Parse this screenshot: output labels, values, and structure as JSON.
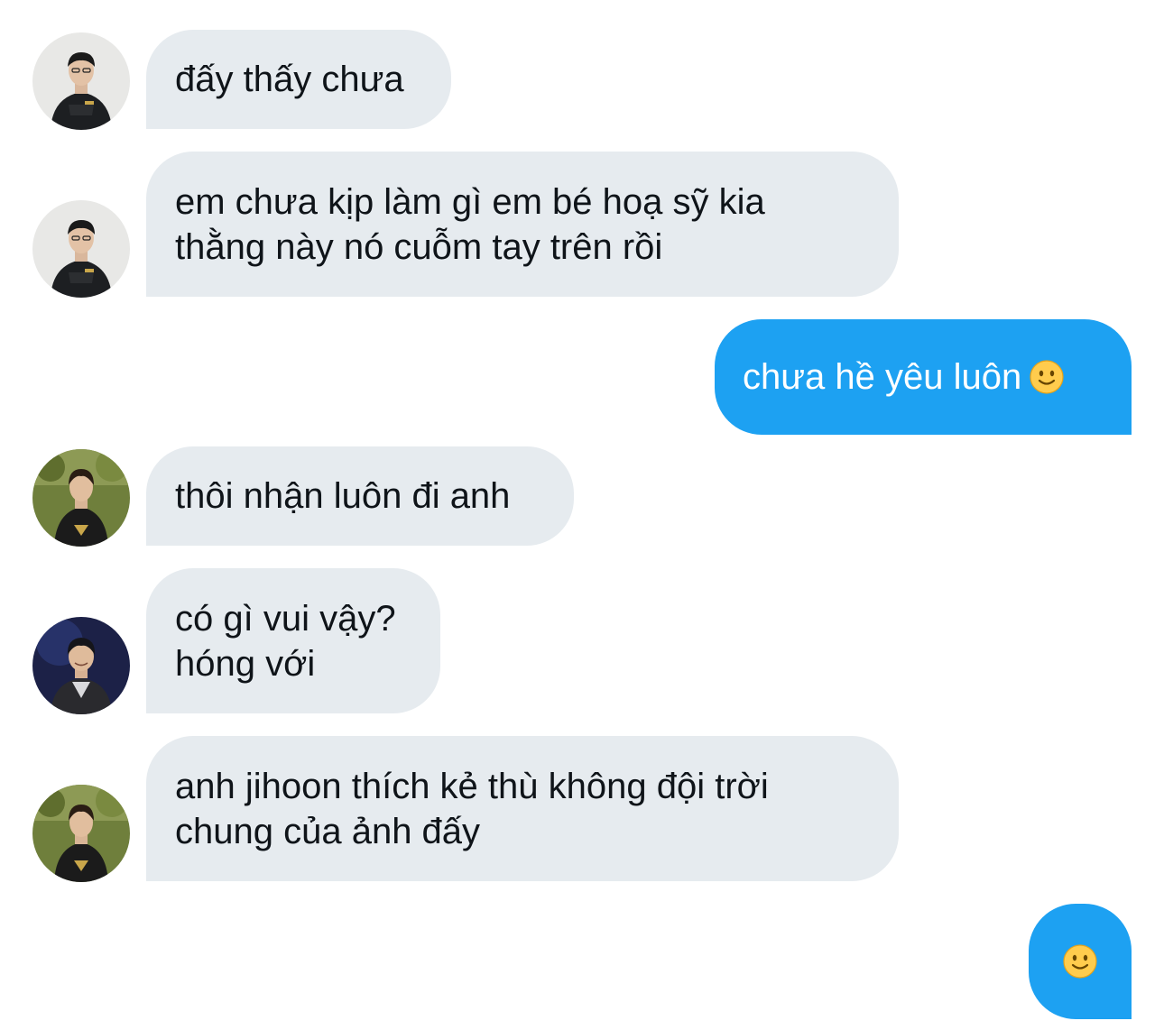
{
  "conversation": {
    "messages": [
      {
        "sender": "other",
        "avatar": "avatar-black-jacket",
        "lines": [
          "đấy thấy chưa"
        ]
      },
      {
        "sender": "other",
        "avatar": "avatar-black-jacket",
        "lines": [
          "em chưa kịp làm gì em bé hoạ sỹ kia",
          "thằng này nó cuỗm tay trên rồi"
        ]
      },
      {
        "sender": "me",
        "lines": [
          "chưa hề yêu luôn"
        ],
        "emoji": "slightly-smiling-face"
      },
      {
        "sender": "other",
        "avatar": "avatar-outdoor-jersey",
        "lines": [
          "thôi nhận luôn đi anh"
        ]
      },
      {
        "sender": "other",
        "avatar": "avatar-stage-suit",
        "lines": [
          "có gì vui vậy?",
          "hóng với"
        ]
      },
      {
        "sender": "other",
        "avatar": "avatar-outdoor-jersey",
        "lines": [
          "anh jihoon thích kẻ thù không đội trời",
          "chung của ảnh đấy"
        ]
      },
      {
        "sender": "me",
        "lines": [],
        "emoji": "slightly-smiling-face"
      }
    ]
  },
  "colors": {
    "incoming_bubble": "#e6ebef",
    "outgoing_bubble": "#1da1f2",
    "incoming_text": "#0f1419",
    "outgoing_text": "#ffffff"
  }
}
